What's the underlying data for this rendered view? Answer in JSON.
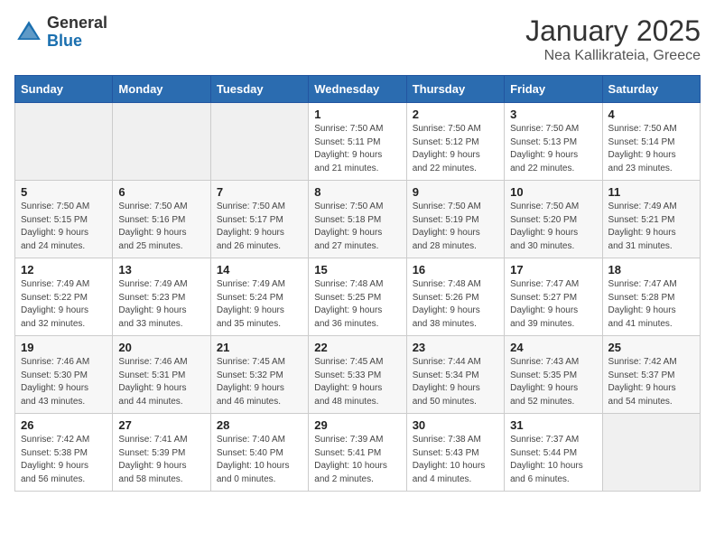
{
  "header": {
    "logo_general": "General",
    "logo_blue": "Blue",
    "month_title": "January 2025",
    "location": "Nea Kallikrateia, Greece"
  },
  "weekdays": [
    "Sunday",
    "Monday",
    "Tuesday",
    "Wednesday",
    "Thursday",
    "Friday",
    "Saturday"
  ],
  "weeks": [
    [
      {
        "day": "",
        "info": ""
      },
      {
        "day": "",
        "info": ""
      },
      {
        "day": "",
        "info": ""
      },
      {
        "day": "1",
        "info": "Sunrise: 7:50 AM\nSunset: 5:11 PM\nDaylight: 9 hours\nand 21 minutes."
      },
      {
        "day": "2",
        "info": "Sunrise: 7:50 AM\nSunset: 5:12 PM\nDaylight: 9 hours\nand 22 minutes."
      },
      {
        "day": "3",
        "info": "Sunrise: 7:50 AM\nSunset: 5:13 PM\nDaylight: 9 hours\nand 22 minutes."
      },
      {
        "day": "4",
        "info": "Sunrise: 7:50 AM\nSunset: 5:14 PM\nDaylight: 9 hours\nand 23 minutes."
      }
    ],
    [
      {
        "day": "5",
        "info": "Sunrise: 7:50 AM\nSunset: 5:15 PM\nDaylight: 9 hours\nand 24 minutes."
      },
      {
        "day": "6",
        "info": "Sunrise: 7:50 AM\nSunset: 5:16 PM\nDaylight: 9 hours\nand 25 minutes."
      },
      {
        "day": "7",
        "info": "Sunrise: 7:50 AM\nSunset: 5:17 PM\nDaylight: 9 hours\nand 26 minutes."
      },
      {
        "day": "8",
        "info": "Sunrise: 7:50 AM\nSunset: 5:18 PM\nDaylight: 9 hours\nand 27 minutes."
      },
      {
        "day": "9",
        "info": "Sunrise: 7:50 AM\nSunset: 5:19 PM\nDaylight: 9 hours\nand 28 minutes."
      },
      {
        "day": "10",
        "info": "Sunrise: 7:50 AM\nSunset: 5:20 PM\nDaylight: 9 hours\nand 30 minutes."
      },
      {
        "day": "11",
        "info": "Sunrise: 7:49 AM\nSunset: 5:21 PM\nDaylight: 9 hours\nand 31 minutes."
      }
    ],
    [
      {
        "day": "12",
        "info": "Sunrise: 7:49 AM\nSunset: 5:22 PM\nDaylight: 9 hours\nand 32 minutes."
      },
      {
        "day": "13",
        "info": "Sunrise: 7:49 AM\nSunset: 5:23 PM\nDaylight: 9 hours\nand 33 minutes."
      },
      {
        "day": "14",
        "info": "Sunrise: 7:49 AM\nSunset: 5:24 PM\nDaylight: 9 hours\nand 35 minutes."
      },
      {
        "day": "15",
        "info": "Sunrise: 7:48 AM\nSunset: 5:25 PM\nDaylight: 9 hours\nand 36 minutes."
      },
      {
        "day": "16",
        "info": "Sunrise: 7:48 AM\nSunset: 5:26 PM\nDaylight: 9 hours\nand 38 minutes."
      },
      {
        "day": "17",
        "info": "Sunrise: 7:47 AM\nSunset: 5:27 PM\nDaylight: 9 hours\nand 39 minutes."
      },
      {
        "day": "18",
        "info": "Sunrise: 7:47 AM\nSunset: 5:28 PM\nDaylight: 9 hours\nand 41 minutes."
      }
    ],
    [
      {
        "day": "19",
        "info": "Sunrise: 7:46 AM\nSunset: 5:30 PM\nDaylight: 9 hours\nand 43 minutes."
      },
      {
        "day": "20",
        "info": "Sunrise: 7:46 AM\nSunset: 5:31 PM\nDaylight: 9 hours\nand 44 minutes."
      },
      {
        "day": "21",
        "info": "Sunrise: 7:45 AM\nSunset: 5:32 PM\nDaylight: 9 hours\nand 46 minutes."
      },
      {
        "day": "22",
        "info": "Sunrise: 7:45 AM\nSunset: 5:33 PM\nDaylight: 9 hours\nand 48 minutes."
      },
      {
        "day": "23",
        "info": "Sunrise: 7:44 AM\nSunset: 5:34 PM\nDaylight: 9 hours\nand 50 minutes."
      },
      {
        "day": "24",
        "info": "Sunrise: 7:43 AM\nSunset: 5:35 PM\nDaylight: 9 hours\nand 52 minutes."
      },
      {
        "day": "25",
        "info": "Sunrise: 7:42 AM\nSunset: 5:37 PM\nDaylight: 9 hours\nand 54 minutes."
      }
    ],
    [
      {
        "day": "26",
        "info": "Sunrise: 7:42 AM\nSunset: 5:38 PM\nDaylight: 9 hours\nand 56 minutes."
      },
      {
        "day": "27",
        "info": "Sunrise: 7:41 AM\nSunset: 5:39 PM\nDaylight: 9 hours\nand 58 minutes."
      },
      {
        "day": "28",
        "info": "Sunrise: 7:40 AM\nSunset: 5:40 PM\nDaylight: 10 hours\nand 0 minutes."
      },
      {
        "day": "29",
        "info": "Sunrise: 7:39 AM\nSunset: 5:41 PM\nDaylight: 10 hours\nand 2 minutes."
      },
      {
        "day": "30",
        "info": "Sunrise: 7:38 AM\nSunset: 5:43 PM\nDaylight: 10 hours\nand 4 minutes."
      },
      {
        "day": "31",
        "info": "Sunrise: 7:37 AM\nSunset: 5:44 PM\nDaylight: 10 hours\nand 6 minutes."
      },
      {
        "day": "",
        "info": ""
      }
    ]
  ]
}
